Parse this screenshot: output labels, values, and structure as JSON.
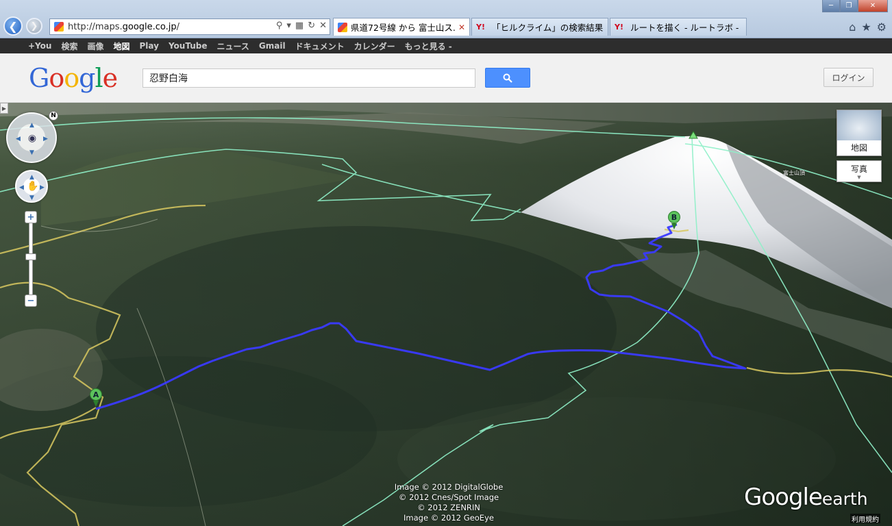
{
  "browser": {
    "address_protocol": "http://maps.",
    "address_host": "google.co.jp",
    "address_path": "/",
    "tabs": [
      {
        "label": "県道72号線 から 富士山ス...",
        "active": true
      },
      {
        "label": "「ヒルクライム」の検索結果 ...",
        "active": false
      },
      {
        "label": "ルートを描く - ルートラボ - ...",
        "active": false
      }
    ],
    "yahoo_favicon": "Y!"
  },
  "google_bar": {
    "items": [
      "+You",
      "検索",
      "画像",
      "地図",
      "Play",
      "YouTube",
      "ニュース",
      "Gmail",
      "ドキュメント",
      "カレンダー",
      "もっと見る -"
    ]
  },
  "header": {
    "logo": [
      "G",
      "o",
      "o",
      "g",
      "l",
      "e"
    ],
    "search_value": "忍野白海",
    "login_label": "ログイン"
  },
  "map": {
    "compass_letter": "N",
    "map_type_label": "地図",
    "photo_label": "写真",
    "marker_a": "A",
    "marker_b": "B",
    "peak_label": "富士山頂",
    "copyright_lines": [
      "Image © 2012 DigitalGlobe",
      "© 2012 Cnes/Spot Image",
      "© 2012 ZENRIN",
      "Image © 2012 GeoEye"
    ],
    "brand_google": "Google",
    "brand_earth": "earth",
    "terms_label": "利用規約",
    "route_color": "#3a3aff",
    "road_color": "#d8c860",
    "boundary_color": "#8ff0c8"
  }
}
